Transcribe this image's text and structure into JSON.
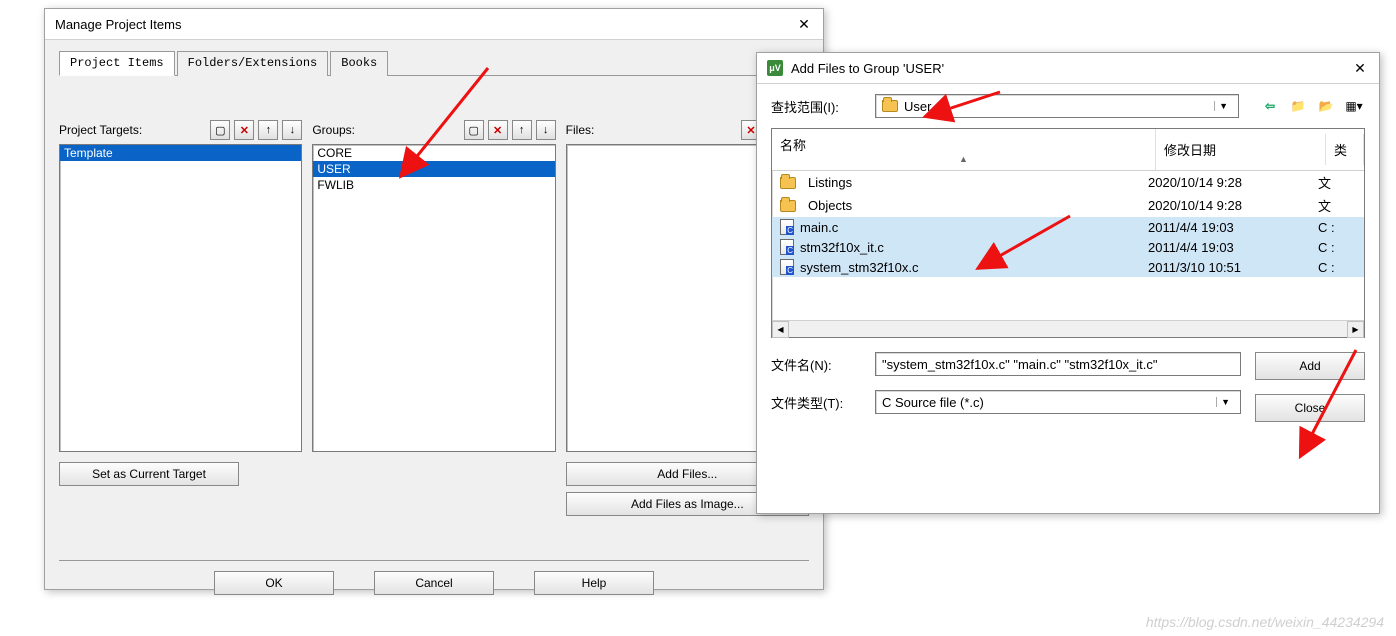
{
  "mpi": {
    "title": "Manage Project Items",
    "tabs": [
      "Project Items",
      "Folders/Extensions",
      "Books"
    ],
    "col_targets": {
      "label": "Project Targets:",
      "items": [
        "Template"
      ],
      "selected": 0
    },
    "col_groups": {
      "label": "Groups:",
      "items": [
        "CORE",
        "USER",
        "FWLIB"
      ],
      "selected": 1
    },
    "col_files": {
      "label": "Files:",
      "items": []
    },
    "btn_set_target": "Set as Current Target",
    "btn_add_files": "Add Files...",
    "btn_add_image": "Add Files as Image...",
    "btn_ok": "OK",
    "btn_cancel": "Cancel",
    "btn_help": "Help",
    "tb_new_title": "New",
    "tb_del_title": "Delete",
    "tb_up_title": "Move Up",
    "tb_dn_title": "Move Down"
  },
  "add": {
    "title": "Add Files to Group 'USER'",
    "lookin_label": "查找范围(I):",
    "lookin_value": "User",
    "nav": {
      "back": "Back",
      "up": "Up Folder",
      "new": "New Folder",
      "view": "View"
    },
    "head_sort": "▲",
    "head_name": "名称",
    "head_date": "修改日期",
    "head_type": "类",
    "rows": [
      {
        "icon": "folder",
        "name": "Listings",
        "date": "2020/10/14 9:28",
        "type": "文",
        "sel": false
      },
      {
        "icon": "folder",
        "name": "Objects",
        "date": "2020/10/14 9:28",
        "type": "文",
        "sel": false
      },
      {
        "icon": "c",
        "name": "main.c",
        "date": "2011/4/4 19:03",
        "type": "C :",
        "sel": true
      },
      {
        "icon": "c",
        "name": "stm32f10x_it.c",
        "date": "2011/4/4 19:03",
        "type": "C :",
        "sel": true
      },
      {
        "icon": "c",
        "name": "system_stm32f10x.c",
        "date": "2011/3/10 10:51",
        "type": "C :",
        "sel": true
      }
    ],
    "filename_label": "文件名(N):",
    "filename_value": "\"system_stm32f10x.c\" \"main.c\" \"stm32f10x_it.c\"",
    "filetype_label": "文件类型(T):",
    "filetype_value": "C Source file (*.c)",
    "btn_add": "Add",
    "btn_close": "Close"
  },
  "watermark": "https://blog.csdn.net/weixin_44234294"
}
